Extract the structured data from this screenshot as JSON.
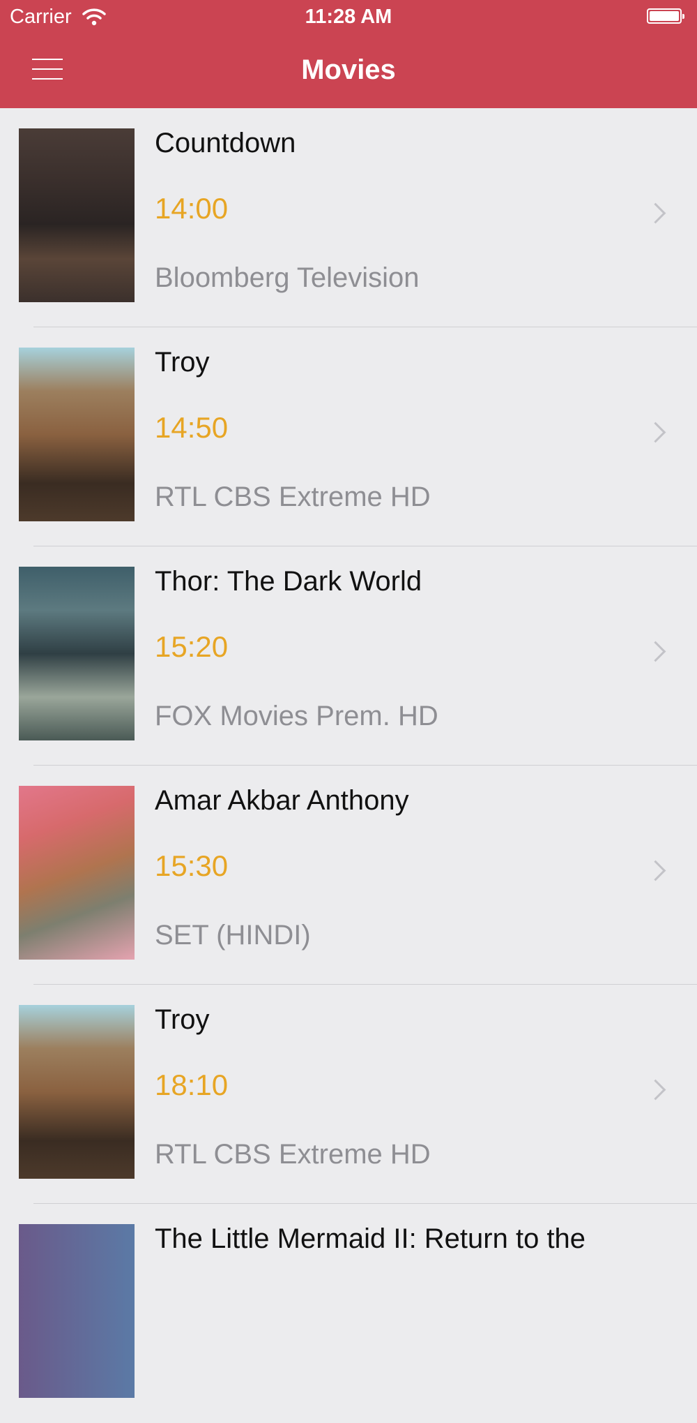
{
  "status_bar": {
    "carrier": "Carrier",
    "time": "11:28 AM",
    "wifi_icon": "wifi-icon",
    "battery_icon": "battery-icon"
  },
  "nav": {
    "title": "Movies",
    "menu_icon": "hamburger-menu-icon"
  },
  "colors": {
    "accent": "#cb4452",
    "time": "#e7a524",
    "channel": "#8e8e93",
    "background": "#ececee"
  },
  "movies": [
    {
      "title": "Countdown",
      "time": "14:00",
      "channel": "Bloomberg Television"
    },
    {
      "title": "Troy",
      "time": "14:50",
      "channel": "RTL CBS Extreme HD"
    },
    {
      "title": "Thor: The Dark World",
      "time": "15:20",
      "channel": "FOX Movies Prem. HD"
    },
    {
      "title": "Amar Akbar Anthony",
      "time": "15:30",
      "channel": "SET (HINDI)"
    },
    {
      "title": "Troy",
      "time": "18:10",
      "channel": "RTL CBS Extreme HD"
    },
    {
      "title": "The Little Mermaid II: Return to the",
      "time": "",
      "channel": ""
    }
  ]
}
